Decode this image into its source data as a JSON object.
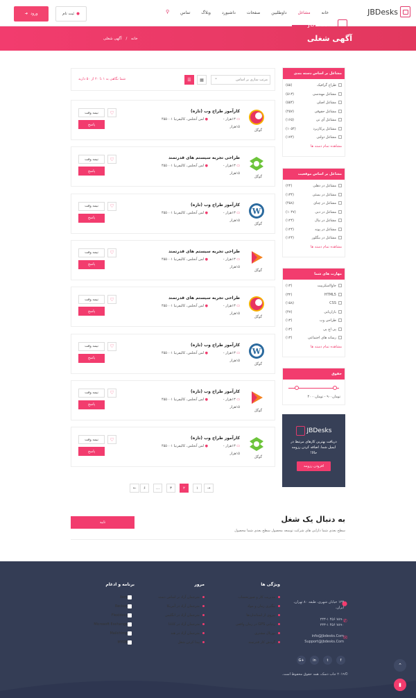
{
  "brand": "JBDesks",
  "nav": [
    "خانه",
    "مشاغل",
    "داوطلبین",
    "صفحات",
    "داشبورد",
    "وبلاگ",
    "تماس"
  ],
  "header": {
    "register": "ثبت نام",
    "login": "ورود"
  },
  "banner": {
    "title": "آگهی شغلی",
    "crumb_home": "خانه",
    "crumb_sep": "/",
    "crumb_current": "آگهی شغلی"
  },
  "sidebar": {
    "categories": {
      "title": "مشاغل بر اساس دسته بندی",
      "items": [
        {
          "label": "طراح گرافیک",
          "count": "(۵۵)"
        },
        {
          "label": "مشاغل مهندسی",
          "count": "(۵۱۳)"
        },
        {
          "label": "مشاغل اصلی",
          "count": "(۵۵۴)"
        },
        {
          "label": "مشاغل حقوقی",
          "count": "(۴۵۷)"
        },
        {
          "label": "مشاغل آی تی",
          "count": "(۱۶۵)"
        },
        {
          "label": "مشاغل پرکاربرد",
          "count": "(۱۰۵۴)"
        },
        {
          "label": "مشاغل دولتی",
          "count": "(۱۷۴)"
        }
      ],
      "more": "مشاهده تمام دسته ها"
    },
    "locations": {
      "title": "مشاغل بر اساس موقعیت",
      "items": [
        {
          "label": "مشاغل در دهلی",
          "count": "(۲۴)"
        },
        {
          "label": "مشاغل در بمبئی",
          "count": "(۱۳۴)"
        },
        {
          "label": "مشاغل در چنای",
          "count": "(۴۵۸)"
        },
        {
          "label": "مشاغل در دبی",
          "count": "(۱۰۴۷)"
        },
        {
          "label": "مشاغل در نپال",
          "count": "(۱۲۴)"
        },
        {
          "label": "مشاغل در پونه",
          "count": "(۱۲۴)"
        },
        {
          "label": "مشاغل در بنگلور",
          "count": "(۱۲۴)"
        }
      ],
      "more": "مشاهده تمام دسته ها"
    },
    "skills": {
      "title": "مهارت های شما",
      "items": [
        {
          "label": "جاوااسکریپت",
          "count": "(۱۳)"
        },
        {
          "label": "HTML5",
          "count": "(۳۲)"
        },
        {
          "label": "CSS",
          "count": "(۱۵۸)"
        },
        {
          "label": "بازاریابی",
          "count": "(۴۷)"
        },
        {
          "label": "طراحی وب",
          "count": "(۱۳)"
        },
        {
          "label": "پی اچ پی",
          "count": "(۱۳)"
        },
        {
          "label": "رسانه های اجتماعی",
          "count": "(۱۳)"
        }
      ],
      "more": "مشاهده تمام دسته ها"
    },
    "salary": {
      "title": "حقوق",
      "range_text": "تومان۹۰۰ - تومان۴۰۰۰",
      "range_min": 0.12,
      "range_max": 0.88
    },
    "promo": {
      "brand": "JBDesks",
      "text": "دریافت بهترین کارهای مرتبط در ایمیل شما. اضافه کردن رزومه حالا!",
      "button": "افزودن رزومه"
    }
  },
  "toolbar": {
    "sort": "مرتب سازی بر اساس",
    "count": "شما نگاهی به ۱ تا ۲۰ از ۵۰ دارید"
  },
  "jobs": [
    {
      "title": "کارآموز طراح وب (تازه)",
      "salary": "۱۳هزار -",
      "salary2": "۱۵هزار",
      "location": "لس آنجلس، کالیفرنیا ۴۵۵۰۰۱",
      "company": "گوگل",
      "type": "نیمه وقت",
      "apply": "پاسخ",
      "logo": "pink"
    },
    {
      "title": "طراحی تجربه سیستم های قدرتمند",
      "salary": "۱۳هزار -",
      "salary2": "۱۵هزار",
      "location": "لس آنجلس، کالیفرنیا ۴۵۵۰۰۱",
      "company": "گوگل",
      "type": "نیمه وقت",
      "apply": "پاسخ",
      "logo": "green"
    },
    {
      "title": "کارآموز طراح وب (تازه)",
      "salary": "۱۳هزار -",
      "salary2": "۱۵هزار",
      "location": "لس آنجلس، کالیفرنیا ۴۵۵۰۰۱",
      "company": "گوگل",
      "type": "نیمه وقت",
      "apply": "پاسخ",
      "logo": "wp"
    },
    {
      "title": "طراحی تجربه سیستم های قدرتمند",
      "salary": "۱۳هزار -",
      "salary2": "۱۵هزار",
      "location": "لس آنجلس، کالیفرنیا ۴۵۵۰۰۱",
      "company": "گوگل",
      "type": "نیمه وقت",
      "apply": "پاسخ",
      "logo": "play"
    },
    {
      "title": "طراحی تجربه سیستم های قدرتمند",
      "salary": "۱۳هزار -",
      "salary2": "۱۵هزار",
      "location": "لس آنجلس، کالیفرنیا ۴۵۵۰۰۱",
      "company": "گوگل",
      "type": "نیمه وقت",
      "apply": "پاسخ",
      "logo": "pink"
    },
    {
      "title": "کارآموز طراح وب (تازه)",
      "salary": "۱۳هزار -",
      "salary2": "۱۵هزار",
      "location": "لس آنجلس، کالیفرنیا ۴۵۵۰۰۱",
      "company": "گوگل",
      "type": "نیمه وقت",
      "apply": "پاسخ",
      "logo": "wp"
    },
    {
      "title": "کارآموز طراح وب (تازه)",
      "salary": "۱۳هزار -",
      "salary2": "۱۵هزار",
      "location": "لس آنجلس، کالیفرنیا ۴۵۵۰۰۱",
      "company": "گوگل",
      "type": "نیمه وقت",
      "apply": "پاسخ",
      "logo": "play"
    },
    {
      "title": "کارآموز طراح وب (تازه)",
      "salary": "۱۳هزار -",
      "salary2": "۱۵هزار",
      "location": "لس آنجلس، کالیفرنیا ۴۵۵۰۰۱",
      "company": "گوگل",
      "type": "نیمه وقت",
      "apply": "پاسخ",
      "logo": "green"
    }
  ],
  "pagination": [
    "→",
    "۱",
    "۲",
    "۳",
    "...",
    "۶",
    "←"
  ],
  "follow": {
    "title": "به دنبال یک شغل",
    "sub": "سطح بعدی شما دارایی های شرکت توسعه محصول سطح بعدی شما محصول",
    "button": "تایید"
  },
  "footer": {
    "brand": "JBDesks",
    "address": "۱۲۳ خیابان شهری، طبقه ۸۰ تهران، ایران.",
    "phone1": "۷۸۹۰ ۴۵۶ ۲۳۳-۱",
    "phone2": "۷۸۹۰ ۴۵۶ ۲۳۳-۱",
    "email1": "info@Jbdesks.Com",
    "email2": "Support@jbdesks.Com",
    "features": {
      "title": "ویژگی ها",
      "items": [
        "مدیریت کار و صورتحساب",
        "پیگیری زمان و مواد",
        "پیروی از استانداردها",
        "ردیابی GPS در زمان واقعی",
        "پورتال مشتری",
        "گردش کار قدرتمند"
      ]
    },
    "mor": {
      "title": "مرور",
      "items": [
        "مترجمان آزاد بر اساس دسته",
        "مترجمان آزاد در آمریکا",
        "مترجمان آزاد در انگلیس",
        "مترجمان آزاد در کانادا",
        "مترجمان آزاد در هند",
        "پیدا کردن شغل"
      ]
    },
    "apps": {
      "title": "برنامه و ادغام",
      "items": [
        "Xero",
        "Reckon",
        "Flexidocs",
        "Microsoft Exchange",
        "Mailchimp",
        "MYOB"
      ]
    },
    "social": [
      "f",
      "t",
      "in",
      "G+"
    ],
    "copyright": "©۲۰۱۹ جاب دسک، همه حقوق محفوظ است."
  }
}
